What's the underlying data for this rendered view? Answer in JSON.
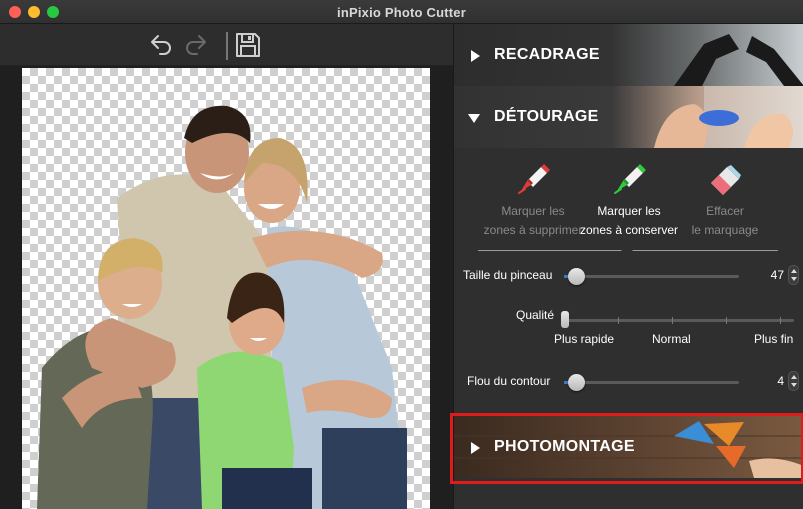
{
  "window": {
    "title": "inPixio Photo Cutter"
  },
  "toolbar": {
    "undo_icon": "undo-icon",
    "redo_icon": "redo-icon",
    "save_icon": "save-icon"
  },
  "sections": {
    "recadrage": {
      "label": "RECADRAGE",
      "expanded": false
    },
    "detourage": {
      "label": "DÉTOURAGE",
      "expanded": true
    },
    "photomontage": {
      "label": "PHOTOMONTAGE",
      "expanded": false
    }
  },
  "tools": [
    {
      "line1": "Marquer les",
      "line2": "zones à supprimer",
      "icon": "red-marker-icon",
      "active": false
    },
    {
      "line1": "Marquer les",
      "line2": "zones à conserver",
      "icon": "green-marker-icon",
      "active": true
    },
    {
      "line1": "Effacer",
      "line2": "le marquage",
      "icon": "eraser-icon",
      "active": false
    }
  ],
  "brush": {
    "label": "Taille du pinceau",
    "value": "47"
  },
  "quality": {
    "label": "Qualité",
    "low": "Plus rapide",
    "mid": "Normal",
    "high": "Plus fin"
  },
  "blur": {
    "label": "Flou du contour",
    "value": "4"
  },
  "colors": {
    "accent": "#3d7fe0",
    "highlight_frame": "#e01b1b",
    "panel_bg": "#2f2f2f"
  }
}
